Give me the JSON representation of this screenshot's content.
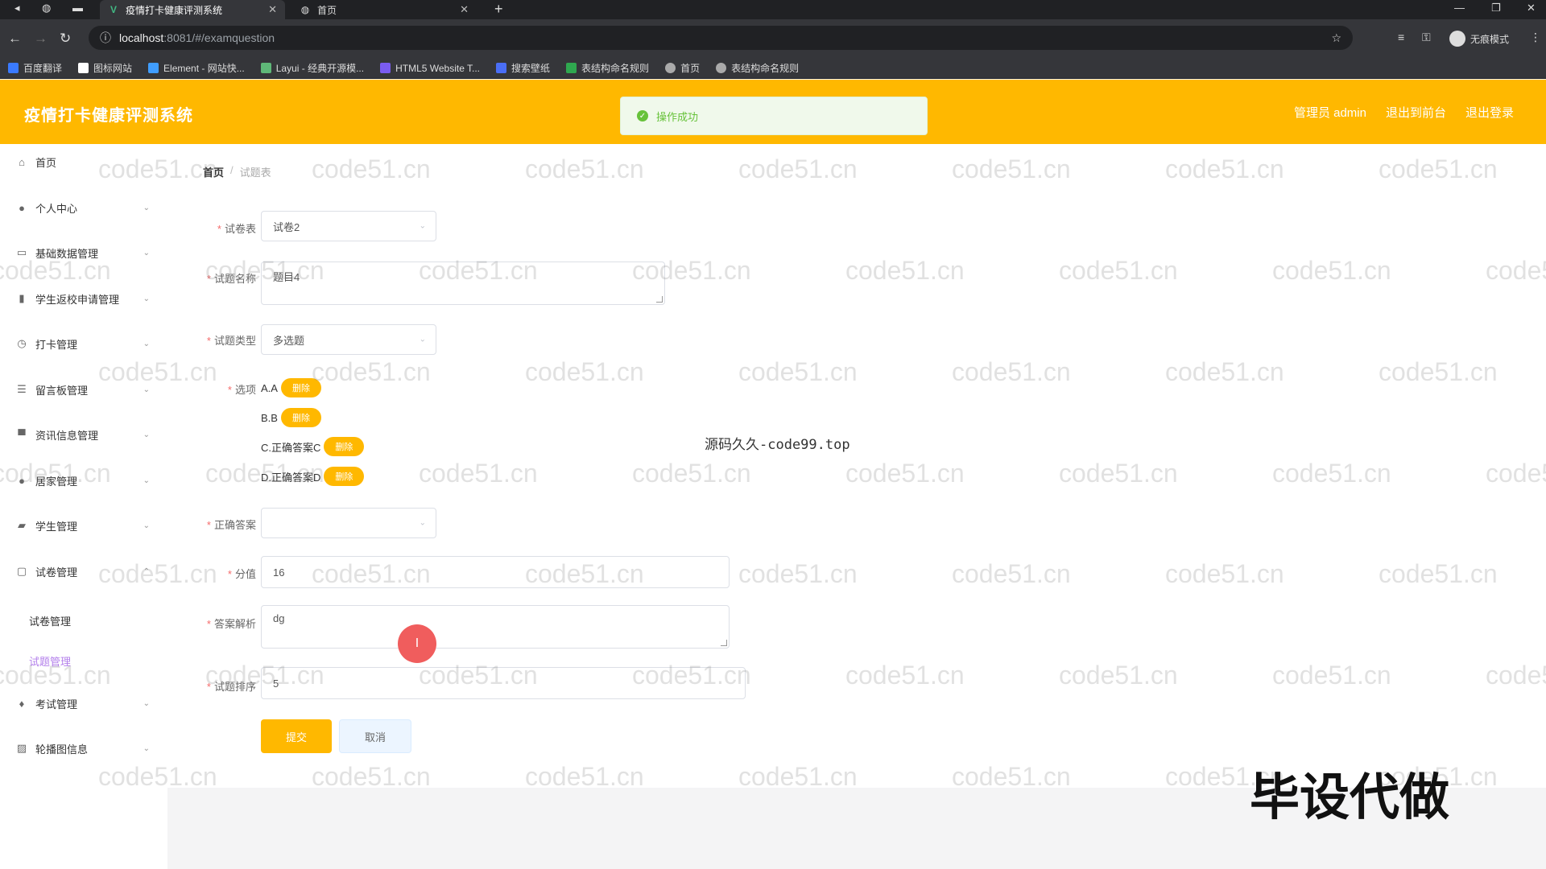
{
  "browser": {
    "tabs": [
      {
        "title": "疫情打卡健康评测系统",
        "active": true
      },
      {
        "title": "首页",
        "active": false
      }
    ],
    "url_host": "localhost",
    "url_path": ":8081/#/examquestion",
    "incognito_label": "无痕模式",
    "bookmarks": [
      "百度翻译",
      "图标网站",
      "Element - 网站快...",
      "Layui - 经典开源模...",
      "HTML5 Website T...",
      "搜索壁纸",
      "表结构命名规则",
      "首页",
      "表结构命名规则"
    ]
  },
  "header": {
    "brand": "疫情打卡健康评测系统",
    "admin": "管理员 admin",
    "to_front": "退出到前台",
    "logout": "退出登录"
  },
  "toast": {
    "message": "操作成功"
  },
  "sidebar": {
    "items": [
      {
        "label": "首页",
        "icon": "home-icon"
      },
      {
        "label": "个人中心",
        "icon": "user-icon"
      },
      {
        "label": "基础数据管理",
        "icon": "card-icon"
      },
      {
        "label": "学生返校申请管理",
        "icon": "chart-icon"
      },
      {
        "label": "打卡管理",
        "icon": "clock-icon"
      },
      {
        "label": "留言板管理",
        "icon": "sliders-icon"
      },
      {
        "label": "资讯信息管理",
        "icon": "monitor-icon"
      },
      {
        "label": "居家管理",
        "icon": "person-icon"
      },
      {
        "label": "学生管理",
        "icon": "briefcase-icon"
      },
      {
        "label": "试卷管理",
        "icon": "paper-icon"
      },
      {
        "label": "考试管理",
        "icon": "mic-icon"
      },
      {
        "label": "轮播图信息",
        "icon": "picture-icon"
      }
    ],
    "subitems": [
      "试卷管理",
      "试题管理"
    ]
  },
  "breadcrumb": {
    "home": "首页",
    "current": "试题表"
  },
  "form": {
    "paper": {
      "label": "试卷表",
      "value": "试卷2"
    },
    "question_name": {
      "label": "试题名称",
      "value": "题目4"
    },
    "question_type": {
      "label": "试题类型",
      "value": "多选题"
    },
    "options": {
      "label": "选项",
      "items": [
        "A.A",
        "B.B",
        "C.正确答案C",
        "D.正确答案D"
      ],
      "delete_label": "删除"
    },
    "correct_answer": {
      "label": "正确答案",
      "value": ""
    },
    "score": {
      "label": "分值",
      "value": "16"
    },
    "analysis": {
      "label": "答案解析",
      "value": "dg"
    },
    "sort": {
      "label": "试题排序",
      "value": "5"
    },
    "submit": "提交",
    "cancel": "取消"
  },
  "overlay": {
    "watermark": "code51.cn",
    "center_text": "源码久久-code99.top",
    "stamp": "毕设代做"
  },
  "colors": {
    "accent": "#ffb800",
    "success": "#67c23a",
    "active_sub": "#b37feb"
  }
}
